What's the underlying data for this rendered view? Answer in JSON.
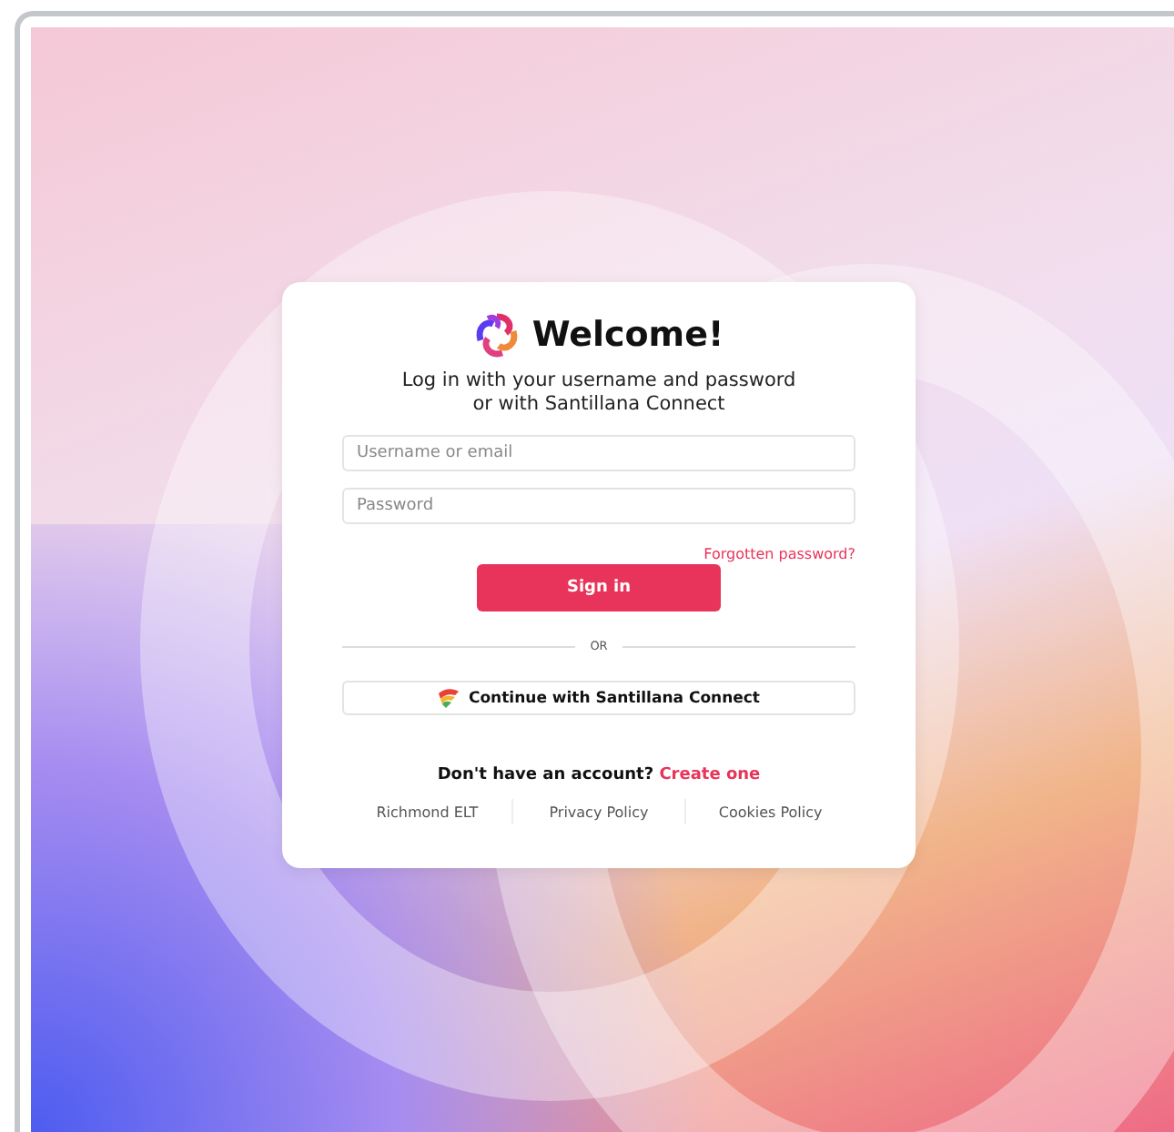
{
  "login": {
    "title": "Welcome!",
    "subtitle": "Log in with your username and password or with Santillana Connect",
    "fields": [
      {
        "placeholder": "Username or email"
      },
      {
        "placeholder": "Password"
      }
    ],
    "forgot_link": "Forgotten password?",
    "sign_in_button": "Sign in",
    "divider": "OR",
    "connect_button": "Continue with Santillana Connect",
    "signup_prompt": "Don't have an account?",
    "signup_link": "Create one",
    "footer_links": [
      "Richmond ELT",
      "Privacy Policy",
      "Cookies Policy"
    ]
  }
}
